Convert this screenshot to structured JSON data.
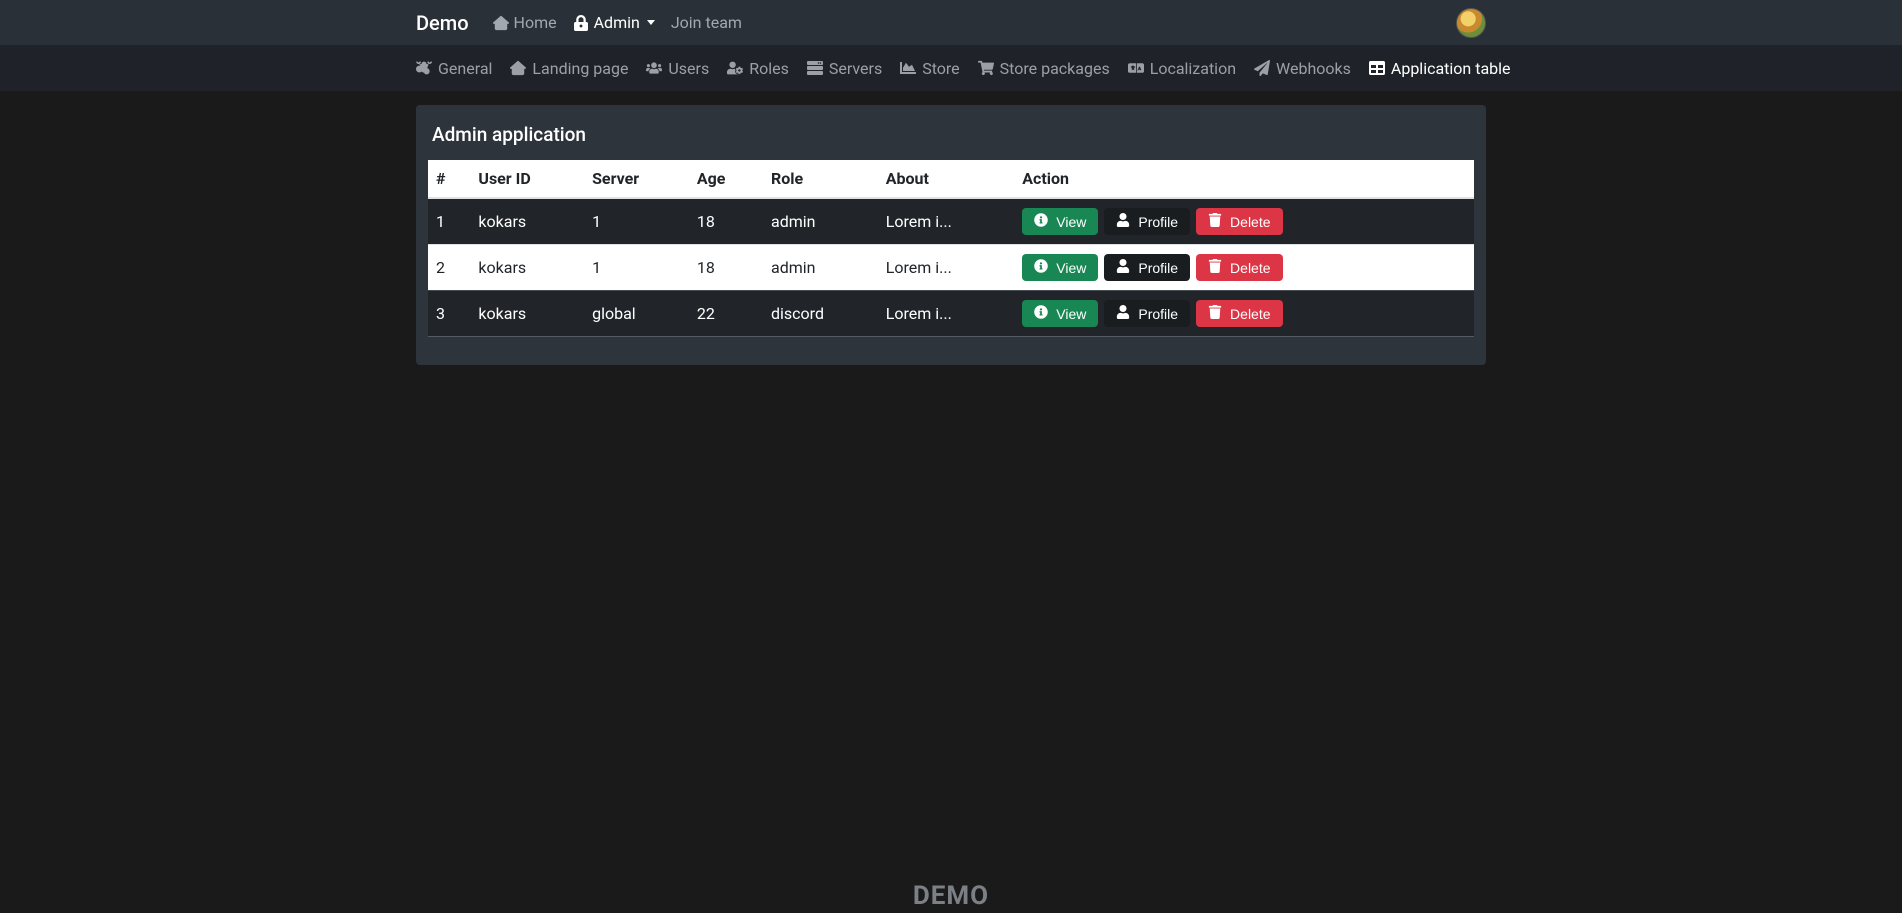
{
  "brand": "Demo",
  "topnav": {
    "home": "Home",
    "admin": "Admin",
    "join": "Join team"
  },
  "subnav": {
    "general": "General",
    "landing": "Landing page",
    "users": "Users",
    "roles": "Roles",
    "servers": "Servers",
    "store": "Store",
    "store_packages": "Store packages",
    "localization": "Localization",
    "webhooks": "Webhooks",
    "application_table": "Application table"
  },
  "card": {
    "title": "Admin application"
  },
  "table": {
    "headers": {
      "index": "#",
      "user_id": "User ID",
      "server": "Server",
      "age": "Age",
      "role": "Role",
      "about": "About",
      "action": "Action"
    },
    "rows": [
      {
        "index": "1",
        "user_id": "kokars",
        "server": "1",
        "age": "18",
        "role": "admin",
        "about": "Lorem i..."
      },
      {
        "index": "2",
        "user_id": "kokars",
        "server": "1",
        "age": "18",
        "role": "admin",
        "about": "Lorem i..."
      },
      {
        "index": "3",
        "user_id": "kokars",
        "server": "global",
        "age": "22",
        "role": "discord",
        "about": "Lorem i..."
      }
    ],
    "buttons": {
      "view": "View",
      "profile": "Profile",
      "delete": "Delete"
    }
  },
  "footer": "DEMO"
}
